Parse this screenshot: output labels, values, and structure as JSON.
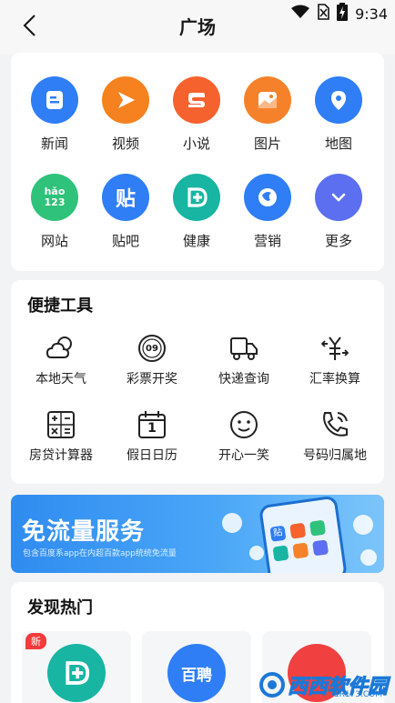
{
  "status": {
    "time": "9:34"
  },
  "nav": {
    "title": "广场"
  },
  "grid": [
    {
      "label": "新闻",
      "icon": "news-icon",
      "color": "#2f7ef5"
    },
    {
      "label": "视频",
      "icon": "video-play-icon",
      "color": "#f5821f"
    },
    {
      "label": "小说",
      "icon": "book-icon",
      "color": "#f5622e"
    },
    {
      "label": "图片",
      "icon": "picture-icon",
      "color": "#f5822a"
    },
    {
      "label": "地图",
      "icon": "map-pin-icon",
      "color": "#2f7ef5"
    },
    {
      "label": "网站",
      "icon": "hao123-icon",
      "color": "#2ec27a",
      "logo": "hǎo 123"
    },
    {
      "label": "贴吧",
      "icon": "tieba-icon",
      "color": "#2f7ef5",
      "glyph": "贴"
    },
    {
      "label": "健康",
      "icon": "health-icon",
      "color": "#17b5a2"
    },
    {
      "label": "营销",
      "icon": "marketing-icon",
      "color": "#2f7ef5"
    },
    {
      "label": "更多",
      "icon": "chevron-down-icon",
      "color": "#5b6ff0"
    }
  ],
  "tools": {
    "title": "便捷工具",
    "items": [
      {
        "label": "本地天气",
        "icon": "weather-icon"
      },
      {
        "label": "彩票开奖",
        "icon": "lottery-icon",
        "glyph": "09"
      },
      {
        "label": "快递查询",
        "icon": "delivery-truck-icon"
      },
      {
        "label": "汇率换算",
        "icon": "exchange-rate-icon"
      },
      {
        "label": "房贷计算器",
        "icon": "calculator-icon"
      },
      {
        "label": "假日日历",
        "icon": "calendar-icon",
        "glyph": "1"
      },
      {
        "label": "开心一笑",
        "icon": "smile-icon"
      },
      {
        "label": "号码归属地",
        "icon": "phone-location-icon"
      }
    ]
  },
  "banner": {
    "title": "免流量服务",
    "subtitle": "包含百度系app在内超百款app统统免流量",
    "phone_tile_glyph": "贴"
  },
  "hot": {
    "title": "发现热门",
    "badge": "新",
    "tiles": [
      {
        "icon": "health-icon",
        "color": "#17b5a2"
      },
      {
        "icon": "baipin-icon",
        "color": "#2f7ef5",
        "text": "百聘"
      },
      {
        "icon": "red-app-icon",
        "color": "#f04040"
      }
    ]
  },
  "watermark": {
    "text": "西西软件园",
    "url": "CR173.COM"
  }
}
